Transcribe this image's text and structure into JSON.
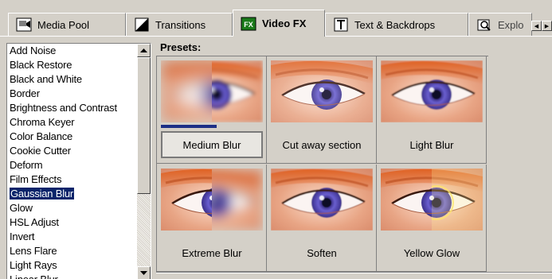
{
  "tabs": [
    {
      "label": "Media Pool",
      "icon": "media-pool-icon"
    },
    {
      "label": "Transitions",
      "icon": "transitions-icon"
    },
    {
      "label": "Video FX",
      "icon": "video-fx-icon",
      "active": true
    },
    {
      "label": "Text & Backdrops",
      "icon": "text-backdrops-icon"
    },
    {
      "label": "Explo",
      "icon": "explorer-icon"
    }
  ],
  "effects": {
    "items": [
      "Add Noise",
      "Black Restore",
      "Black and White",
      "Border",
      "Brightness and Contrast",
      "Chroma Keyer",
      "Color Balance",
      "Cookie Cutter",
      "Deform",
      "Film Effects",
      "Gaussian Blur",
      "Glow",
      "HSL Adjust",
      "Invert",
      "Lens Flare",
      "Light Rays",
      "Linear Blur"
    ],
    "selected": "Gaussian Blur"
  },
  "presets": {
    "label": "Presets:",
    "items": [
      {
        "label": "Medium Blur",
        "effect": "medium-blur",
        "selected": true,
        "progress": 0.55
      },
      {
        "label": "Cut away section",
        "effect": "cut-away"
      },
      {
        "label": "Light Blur",
        "effect": "light-blur"
      },
      {
        "label": "Extreme Blur",
        "effect": "extreme-blur"
      },
      {
        "label": "Soften",
        "effect": "soften"
      },
      {
        "label": "Yellow Glow",
        "effect": "yellow-glow"
      }
    ]
  },
  "colors": {
    "selection": "#0a246a",
    "progress": "#1c2f86",
    "iris": "#6a5fd0",
    "skin": "#e8a585",
    "eye_shadow": "#e06020"
  }
}
